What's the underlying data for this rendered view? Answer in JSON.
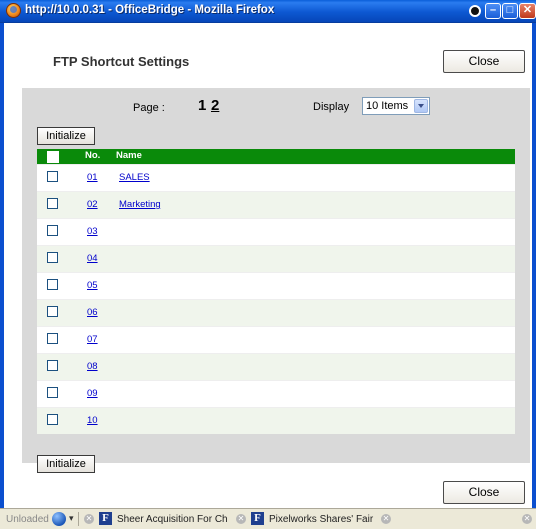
{
  "window": {
    "title": "http://10.0.0.31 - OfficeBridge - Mozilla Firefox"
  },
  "header": {
    "title": "FTP Shortcut Settings",
    "close_label": "Close"
  },
  "pagination": {
    "page_label": "Page :",
    "current_page": "1",
    "other_page": "2",
    "display_label": "Display",
    "display_selected": "10 Items"
  },
  "buttons": {
    "initialize_label": "Initialize",
    "close_label": "Close"
  },
  "table": {
    "columns": [
      "No.",
      "Name"
    ],
    "rows": [
      {
        "no": "01",
        "name": "SALES"
      },
      {
        "no": "02",
        "name": "Marketing"
      },
      {
        "no": "03",
        "name": ""
      },
      {
        "no": "04",
        "name": ""
      },
      {
        "no": "05",
        "name": ""
      },
      {
        "no": "06",
        "name": ""
      },
      {
        "no": "07",
        "name": ""
      },
      {
        "no": "08",
        "name": ""
      },
      {
        "no": "09",
        "name": ""
      },
      {
        "no": "10",
        "name": ""
      }
    ]
  },
  "statusbar": {
    "status": "Unloaded",
    "tab1": "Sheer Acquisition For Ch",
    "tab2": "Pixelworks Shares' Fair"
  },
  "colors": {
    "table_header": "#0a8a0a",
    "link": "#0000cc",
    "titlebar": "#0d58d2"
  }
}
